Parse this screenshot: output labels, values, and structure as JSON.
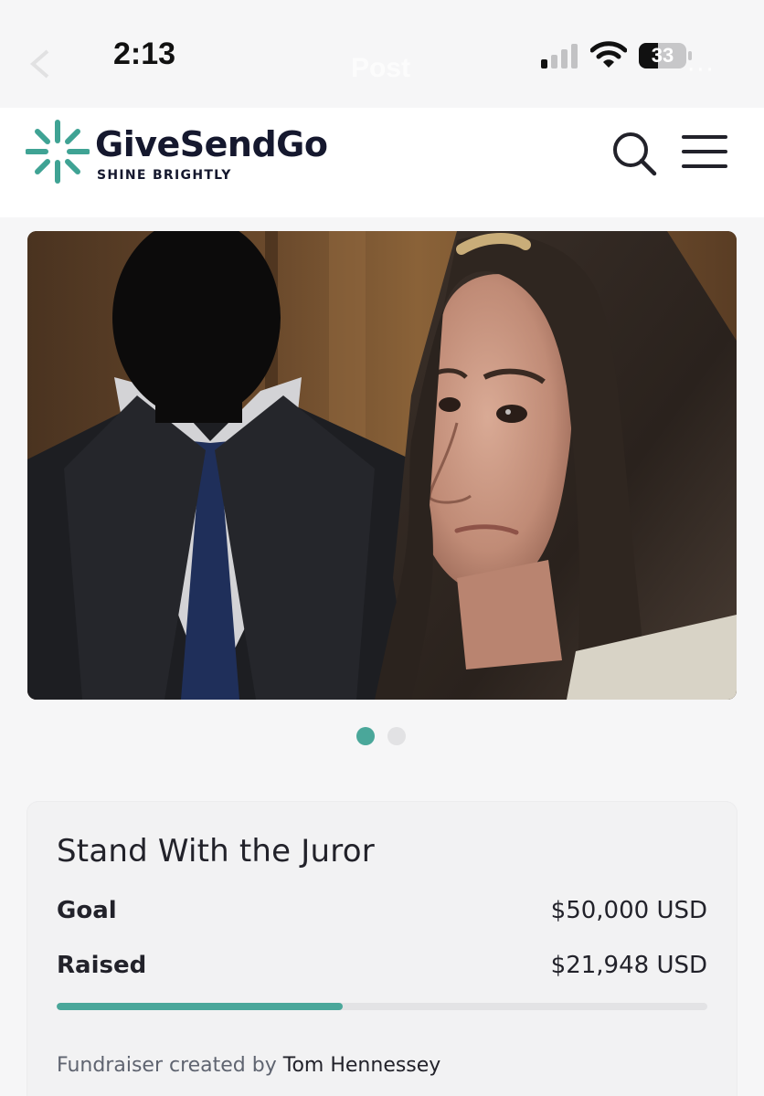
{
  "status_bar": {
    "time": "2:13",
    "battery_level": "33",
    "ghost_title": "Post",
    "ghost_more": "···",
    "icons": [
      "signal-icon",
      "wifi-icon",
      "battery-icon"
    ]
  },
  "header": {
    "brand_name": "GiveSendGo",
    "tagline": "SHINE BRIGHTLY",
    "brand_color": "#3fa394",
    "icons": [
      "search-icon",
      "menu-icon"
    ]
  },
  "hero": {
    "slide_count": 2,
    "active_slide": 1
  },
  "fundraiser": {
    "title": "Stand With the Juror",
    "goal_label": "Goal",
    "goal_value": "$50,000 USD",
    "raised_label": "Raised",
    "raised_value": "$21,948 USD",
    "progress_fraction": 0.439,
    "creator_prefix": "Fundraiser created by",
    "creator_name": "Tom Hennessey",
    "accent_color": "#4aa79a"
  }
}
